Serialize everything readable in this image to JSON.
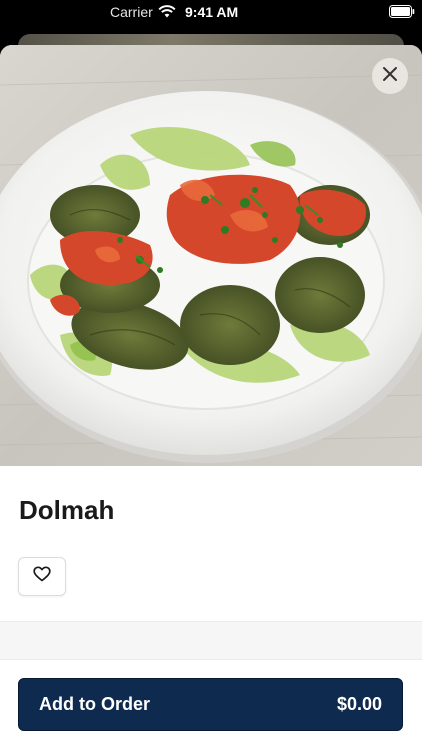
{
  "status_bar": {
    "carrier": "Carrier",
    "time": "9:41 AM",
    "icons": [
      "wifi-icon",
      "battery-icon"
    ]
  },
  "item": {
    "title": "Dolmah",
    "image_alt_icon": "food-photo"
  },
  "actions": {
    "close_icon": "close-icon",
    "favorite_icon": "heart-icon",
    "add_to_order_label": "Add to Order",
    "price": "$0.00"
  },
  "colors": {
    "primary_button": "#0e2a4e",
    "title_text": "#1a1a1a"
  }
}
